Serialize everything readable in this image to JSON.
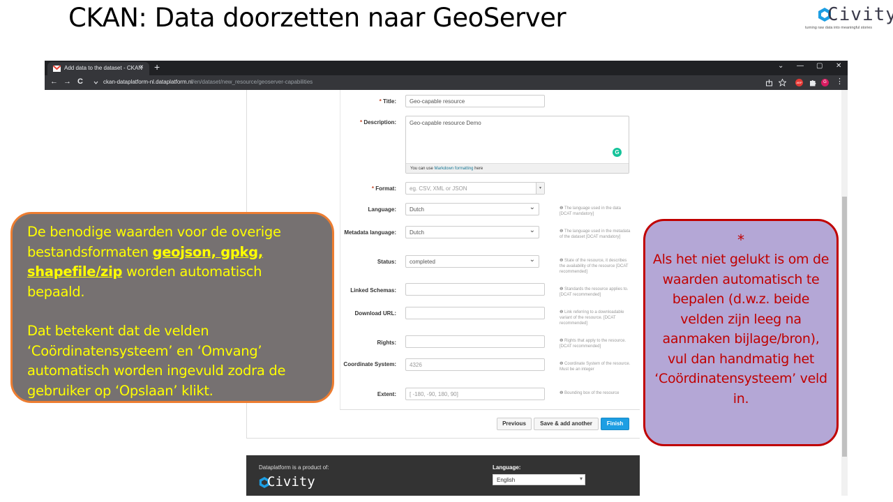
{
  "slide": {
    "title": "CKAN: Data doorzetten naar GeoServer",
    "logo_word": "Civity",
    "logo_tagline": "turning raw data into meaningful stories"
  },
  "browser": {
    "tab_title": "Add data to the dataset - CKAN",
    "tab_close": "×",
    "new_tab": "+",
    "win_min": "—",
    "win_max": "▢",
    "win_close": "✕",
    "win_chevron": "⌄",
    "back": "←",
    "forward": "→",
    "reload": "C",
    "url_host": "ckan-dataplatform-nl.dataplatform.nl",
    "url_path": "/en/dataset/new_resource/geoserver-capabilities",
    "ext_abp": "ABP",
    "ext_profile": "G"
  },
  "form": {
    "title": {
      "label": "Title:",
      "value": "Geo-capable resource"
    },
    "description": {
      "label": "Description:",
      "value": "Geo-capable resource Demo",
      "hint_prefix": "You can use ",
      "hint_link": "Markdown formatting",
      "hint_suffix": " here"
    },
    "format": {
      "label": "Format:",
      "placeholder": "eg. CSV, XML or JSON"
    },
    "language": {
      "label": "Language:",
      "value": "Dutch",
      "help": "The language used in the data [DCAT mandatory]"
    },
    "metadata_language": {
      "label": "Metadata language:",
      "value": "Dutch",
      "help": "The language used in the metadata of the dataset [DCAT mandatory]"
    },
    "status": {
      "label": "Status:",
      "value": "completed",
      "help": "State of the resource, it describes the availability of the resource [DCAT recommended]"
    },
    "linked_schemas": {
      "label": "Linked Schemas:",
      "value": "",
      "help": "Standards the resource applies to. [DCAT recommended]"
    },
    "download_url": {
      "label": "Download URL:",
      "value": "",
      "help": "Link referring to a downloadable variant of the resource. [DCAT recommended]"
    },
    "rights": {
      "label": "Rights:",
      "value": "",
      "help": "Rights that apply to the resource. [DCAT recommended]"
    },
    "coordinate_system": {
      "label": "Coordinate System:",
      "placeholder": "4326",
      "help": "Coordinate System of the resource. Must be an integer"
    },
    "extent": {
      "label": "Extent:",
      "placeholder": "[ -180, -90, 180, 90]",
      "help": "Bounding box of the resource"
    },
    "required_mark": "*",
    "buttons": {
      "previous": "Previous",
      "save_add": "Save & add another",
      "finish": "Finish"
    }
  },
  "footer": {
    "product_of": "Dataplatform is a product of:",
    "logo_word": "Civity",
    "language_label": "Language:",
    "language_value": "English"
  },
  "callouts": {
    "left": {
      "p1_a": "De benodige waarden voor de overige bestandsformaten ",
      "p1_hl": "geojson, gpkg, shapefile/zip",
      "p1_b": " worden automatisch bepaald.",
      "p2": "Dat betekent dat de velden ‘Coördinatensysteem’ en ‘Omvang’ automatisch worden ingevuld zodra de gebruiker op ‘Opslaan’ klikt."
    },
    "right": {
      "star": "*",
      "body": "Als het niet gelukt is om de waarden automatisch te bepalen (d.w.z. beide velden zijn leeg na aanmaken bijlage/bron), vul dan handmatig het ‘Coördinatensysteem’ veld in."
    }
  },
  "colors": {
    "accent_blue": "#1d9ee3",
    "callout_left_border": "#ed7d31",
    "callout_left_text": "#ffff00",
    "callout_right_border": "#c00000",
    "callout_right_fill": "#b4a7d6"
  }
}
